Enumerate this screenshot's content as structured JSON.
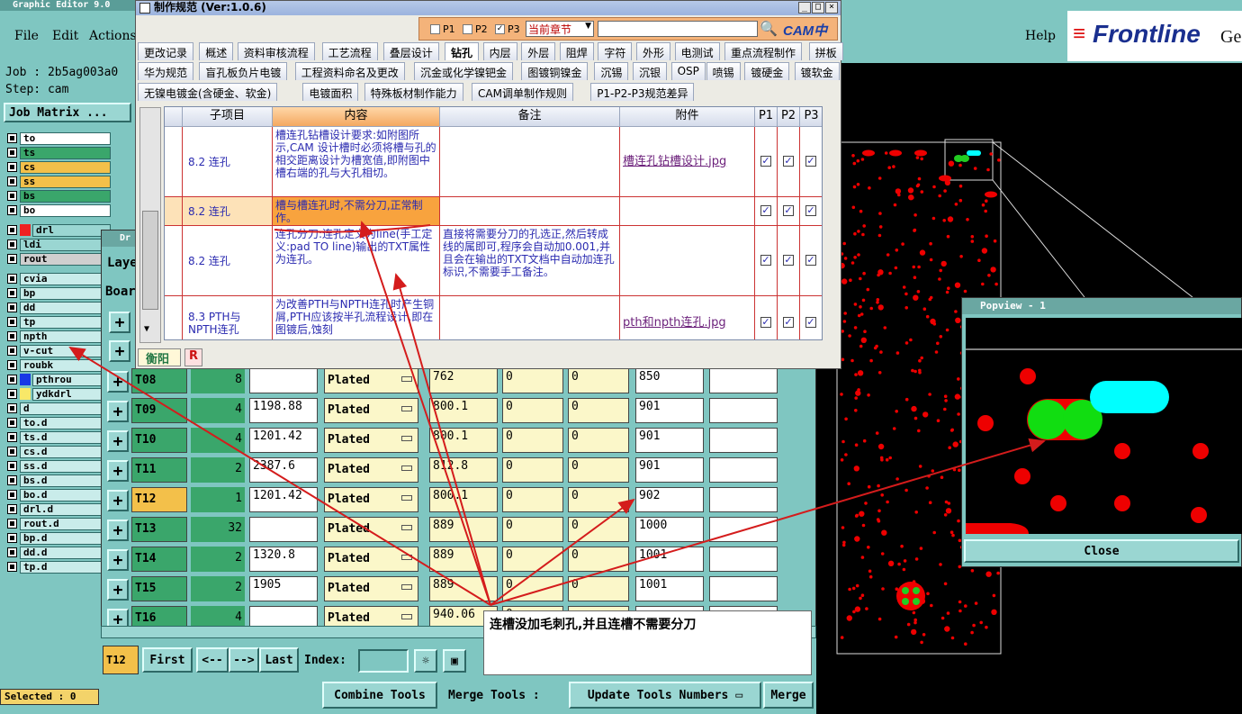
{
  "main": {
    "title": "Graphic Editor 9.0",
    "menu": [
      "File",
      "Edit",
      "Actions"
    ],
    "help": "Help",
    "brand": "Frontline",
    "brand_suffix": "Ge",
    "job_line": "Job : 2b5ag003a0",
    "step_line": "Step: cam",
    "job_matrix": "Job Matrix ...",
    "selected": "Selected : 0"
  },
  "layers": [
    {
      "name": "to",
      "color": "#ffffff"
    },
    {
      "name": "ts",
      "color": "#3aa66b"
    },
    {
      "name": "cs",
      "color": "#f3c04a"
    },
    {
      "name": "ss",
      "color": "#f3c04a"
    },
    {
      "name": "bs",
      "color": "#3aa66b"
    },
    {
      "name": "bo",
      "color": "#ffffff"
    },
    {
      "name": "drl",
      "color": "#9ad6d2"
    },
    {
      "name": "ldi",
      "color": "#9ad6d2"
    },
    {
      "name": "rout",
      "color": "#cfcfcf"
    },
    {
      "name": "cvia",
      "color": "#c9ecea"
    },
    {
      "name": "bp",
      "color": "#c9ecea"
    },
    {
      "name": "dd",
      "color": "#c9ecea"
    },
    {
      "name": "tp",
      "color": "#c9ecea"
    },
    {
      "name": "npth",
      "color": "#c9ecea"
    },
    {
      "name": "v-cut",
      "color": "#c9ecea"
    },
    {
      "name": "roubk",
      "color": "#c9ecea"
    },
    {
      "name": "pthrou",
      "color": "#c9ecea"
    },
    {
      "name": "ydkdrl",
      "color": "#c9ecea"
    },
    {
      "name": "d",
      "color": "#c9ecea"
    },
    {
      "name": "to.d",
      "color": "#c9ecea"
    },
    {
      "name": "ts.d",
      "color": "#c9ecea"
    },
    {
      "name": "cs.d",
      "color": "#c9ecea"
    },
    {
      "name": "ss.d",
      "color": "#c9ecea"
    },
    {
      "name": "bs.d",
      "color": "#c9ecea"
    },
    {
      "name": "bo.d",
      "color": "#c9ecea"
    },
    {
      "name": "drl.d",
      "color": "#c9ecea"
    },
    {
      "name": "rout.d",
      "color": "#c9ecea"
    },
    {
      "name": "bp.d",
      "color": "#c9ecea"
    },
    {
      "name": "dd.d",
      "color": "#c9ecea"
    },
    {
      "name": "tp.d",
      "color": "#c9ecea"
    }
  ],
  "drill": {
    "title": "Dr",
    "lay": "Laye",
    "board": "Boar",
    "rows": [
      {
        "tool": "T08",
        "count": "8",
        "size": "",
        "type": "Plated",
        "finish": "762",
        "p1": "0",
        "p2": "0",
        "p3": "850"
      },
      {
        "tool": "T09",
        "count": "4",
        "size": "1198.88",
        "type": "Plated",
        "finish": "800.1",
        "p1": "0",
        "p2": "0",
        "p3": "901"
      },
      {
        "tool": "T10",
        "count": "4",
        "size": "1201.42",
        "type": "Plated",
        "finish": "800.1",
        "p1": "0",
        "p2": "0",
        "p3": "901"
      },
      {
        "tool": "T11",
        "count": "2",
        "size": "2387.6",
        "type": "Plated",
        "finish": "812.8",
        "p1": "0",
        "p2": "0",
        "p3": "901"
      },
      {
        "tool": "T12",
        "count": "1",
        "size": "1201.42",
        "type": "Plated",
        "finish": "800.1",
        "p1": "0",
        "p2": "0",
        "p3": "902"
      },
      {
        "tool": "T13",
        "count": "32",
        "size": "",
        "type": "Plated",
        "finish": "889",
        "p1": "0",
        "p2": "0",
        "p3": "1000"
      },
      {
        "tool": "T14",
        "count": "2",
        "size": "1320.8",
        "type": "Plated",
        "finish": "889",
        "p1": "0",
        "p2": "0",
        "p3": "1001"
      },
      {
        "tool": "T15",
        "count": "2",
        "size": "1905",
        "type": "Plated",
        "finish": "889",
        "p1": "0",
        "p2": "0",
        "p3": "1001"
      },
      {
        "tool": "T16",
        "count": "4",
        "size": "",
        "type": "Plated",
        "finish": "940.06",
        "p1": "0",
        "p2": "",
        "p3": ""
      }
    ],
    "current_tool": "T12",
    "nav": {
      "first": "First",
      "prev": "<--",
      "next": "-->",
      "last": "Last",
      "index": "Index:"
    },
    "bottom": {
      "combine": "Combine Tools",
      "merge_label": "Merge Tools :",
      "update": "Update Tools Numbers",
      "merge": "Merge"
    }
  },
  "spec": {
    "title": "制作规范 (Ver:1.0.6)",
    "filters": [
      "P1",
      "P2",
      "P3"
    ],
    "section_select": "当前章节",
    "logo": "CAM中心",
    "tabs_row1": [
      "更改记录",
      "概述",
      "资料审核流程",
      "工艺流程",
      "叠层设计",
      "钻孔",
      "内层",
      "外层",
      "阻焊",
      "字符",
      "外形",
      "电测试",
      "重点流程制作",
      "拼板"
    ],
    "tabs_row2": [
      "华为规范",
      "盲孔板负片电镀",
      "工程资料命名及更改",
      "沉金或化学镍钯金",
      "图镀铜镍金",
      "沉锡",
      "沉银",
      "OSP",
      "喷锡",
      "镀硬金",
      "镀软金"
    ],
    "tabs_row3": [
      "无镍电镀金(含硬金、软金)",
      "电镀面积",
      "特殊板材制作能力",
      "CAM调单制作规则",
      "P1-P2-P3规范差异"
    ],
    "headers": [
      "子项目",
      "内容",
      "备注",
      "附件",
      "P1",
      "P2",
      "P3"
    ],
    "rows": [
      {
        "item": "8.2 连孔",
        "content": "槽连孔钻槽设计要求:如附图所示,CAM 设计槽时必须将槽与孔的相交距离设计为槽宽值,即附图中槽右端的孔与大孔相切。",
        "note": "",
        "attach": "槽连孔钻槽设计.jpg"
      },
      {
        "item": "8.2 连孔",
        "content": "槽与槽连孔时,不需分刀,正常制作。",
        "note": "",
        "attach": ""
      },
      {
        "item": "8.2 连孔",
        "content": "连孔分刀:连孔定义为line(手工定义:pad TO line)输出的TXT属性为连孔。",
        "note": "直接将需要分刀的孔选正,然后转成线的属即可,程序会自动加0.001,并且会在输出的TXT文档中自动加连孔标识,不需要手工备注。",
        "attach": ""
      },
      {
        "item": "8.3 PTH与NPTH连孔",
        "content": "为改善PTH与NPTH连孔时产生铜屑,PTH应该按半孔流程设计,即在图镀后,蚀刻",
        "note": "",
        "attach": "pth和npth连孔.jpg"
      }
    ],
    "footer_tab": "衡阳",
    "footer_r": "R"
  },
  "popview": {
    "title": "Popview - 1",
    "close": "Close"
  },
  "note": "连槽没加毛刺孔,并且连槽不需要分刀"
}
